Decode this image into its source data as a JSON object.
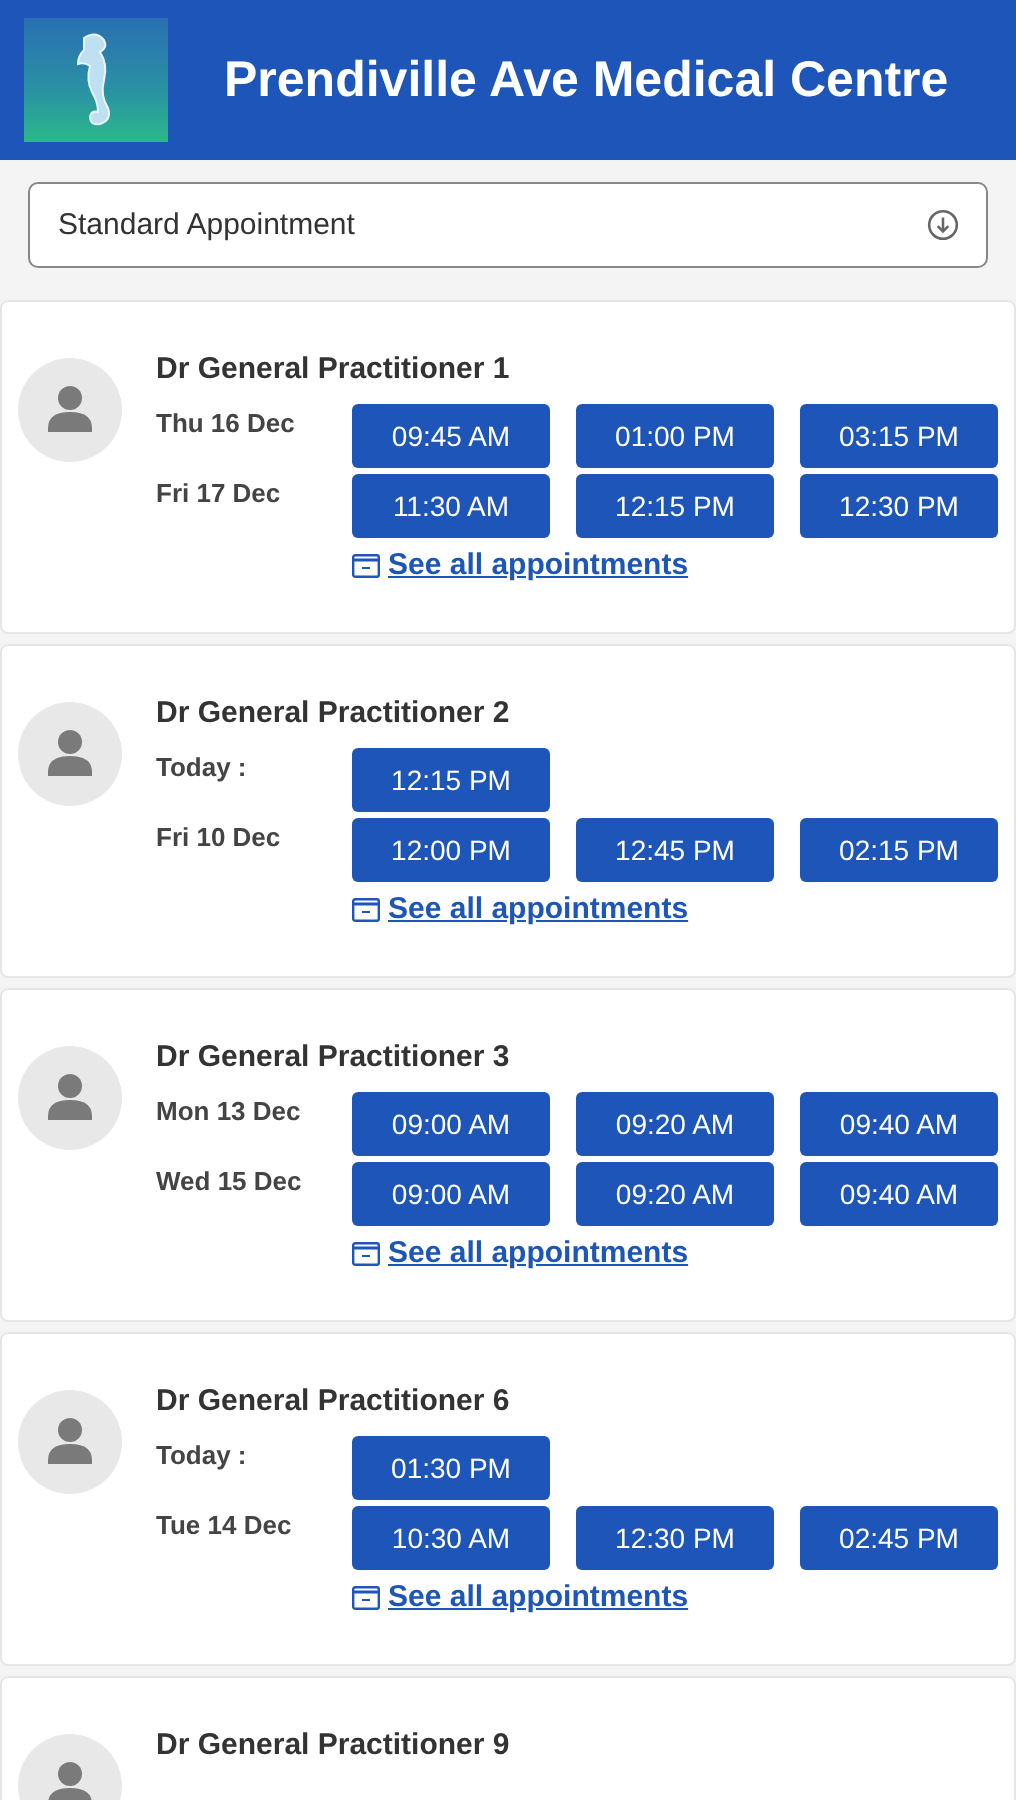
{
  "header": {
    "title": "Prendiville Ave Medical Centre"
  },
  "appointment_type": {
    "value": "Standard Appointment"
  },
  "doctors": [
    {
      "name": "Dr General Practitioner 1",
      "days": [
        {
          "date": "Thu 16 Dec",
          "slots": [
            "09:45 AM",
            "01:00 PM",
            "03:15 PM"
          ]
        },
        {
          "date": "Fri 17 Dec",
          "slots": [
            "11:30 AM",
            "12:15 PM",
            "12:30 PM"
          ]
        }
      ],
      "link": "See all appointments"
    },
    {
      "name": "Dr General Practitioner 2",
      "days": [
        {
          "date": "Today :",
          "slots": [
            "12:15 PM"
          ]
        },
        {
          "date": "Fri 10 Dec",
          "slots": [
            "12:00 PM",
            "12:45 PM",
            "02:15 PM"
          ]
        }
      ],
      "link": "See all appointments"
    },
    {
      "name": "Dr General Practitioner 3",
      "days": [
        {
          "date": "Mon 13 Dec",
          "slots": [
            "09:00 AM",
            "09:20 AM",
            "09:40 AM"
          ]
        },
        {
          "date": "Wed 15 Dec",
          "slots": [
            "09:00 AM",
            "09:20 AM",
            "09:40 AM"
          ]
        }
      ],
      "link": "See all appointments"
    },
    {
      "name": "Dr General Practitioner 6",
      "days": [
        {
          "date": "Today :",
          "slots": [
            "01:30 PM"
          ]
        },
        {
          "date": "Tue 14 Dec",
          "slots": [
            "10:30 AM",
            "12:30 PM",
            "02:45 PM"
          ]
        }
      ],
      "link": "See all appointments"
    },
    {
      "name": "Dr General Practitioner 9"
    }
  ]
}
